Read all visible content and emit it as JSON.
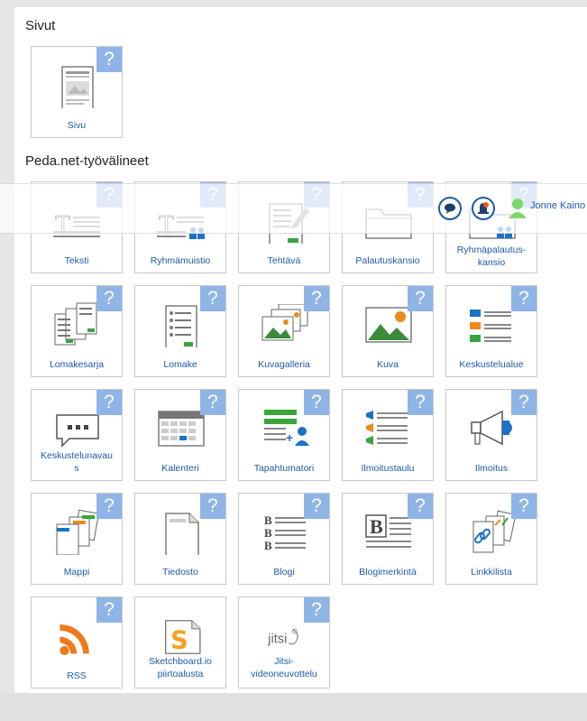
{
  "sections": {
    "pages_title": "Sivut",
    "tools_title": "Peda.net-työvälineet"
  },
  "help_mark": "?",
  "tiles": {
    "sivu": "Sivu",
    "teksti": "Teksti",
    "ryhmamuistio": "Ryhmämuistio",
    "tehtava": "Tehtävä",
    "palautuskansio": "Palautuskansio",
    "ryhmapalautuskansio_1": "Ryhmäpalautus-",
    "ryhmapalautuskansio_2": "kansio",
    "lomakesarja": "Lomakesarja",
    "lomake": "Lomake",
    "kuvagalleria": "Kuvagalleria",
    "kuva": "Kuva",
    "keskustelualue": "Keskustelualue",
    "keskustelunavaus_1": "Keskustelunavau",
    "keskustelunavaus_2": "s",
    "kalenteri": "Kalenteri",
    "tapahtumatori": "Tapahtumatori",
    "ilmoitustaulu": "Ilmoitustaulu",
    "ilmoitus": "Ilmoitus",
    "mappi": "Mappi",
    "tiedosto": "Tiedosto",
    "blogi": "Blogi",
    "blogimerkinta": "Blogimerkintä",
    "linkkilista": "Linkkilista",
    "rss": "RSS",
    "sketchboard_1": "Sketchboard.io",
    "sketchboard_2": "piirtoalusta",
    "jitsi_1": "Jitsi-",
    "jitsi_2": "videoneuvottelu",
    "jitsi_logo_text": "jitsi"
  },
  "user": {
    "name": "Jonne Kaino"
  },
  "icons": {
    "chat": "chat-icon",
    "notifications": "bell-icon",
    "user": "user-icon",
    "help": "help-icon"
  },
  "colors": {
    "help_badge": "#8fb5e6",
    "link_text": "#1c5aa8",
    "accent_green": "#3aa53a",
    "accent_orange": "#ee8a1c",
    "accent_blue": "#1d71c6"
  }
}
